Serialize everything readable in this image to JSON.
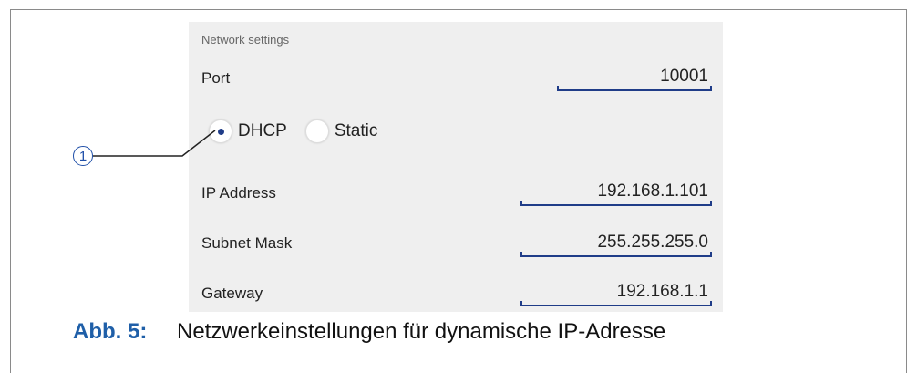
{
  "section_title": "Network settings",
  "fields": {
    "port": {
      "label": "Port",
      "value": "10001"
    },
    "ip": {
      "label": "IP Address",
      "value": "192.168.1.101"
    },
    "mask": {
      "label": "Subnet Mask",
      "value": "255.255.255.0"
    },
    "gateway": {
      "label": "Gateway",
      "value": "192.168.1.1"
    }
  },
  "radios": {
    "dhcp": {
      "label": "DHCP",
      "selected": true
    },
    "static": {
      "label": "Static",
      "selected": false
    }
  },
  "callout": "1",
  "caption": {
    "number": "Abb. 5:",
    "text": "Netzwerkeinstellungen für dynamische IP-Adresse"
  },
  "colors": {
    "accent": "#1f3c88",
    "caption_number": "#1f5fa8"
  }
}
